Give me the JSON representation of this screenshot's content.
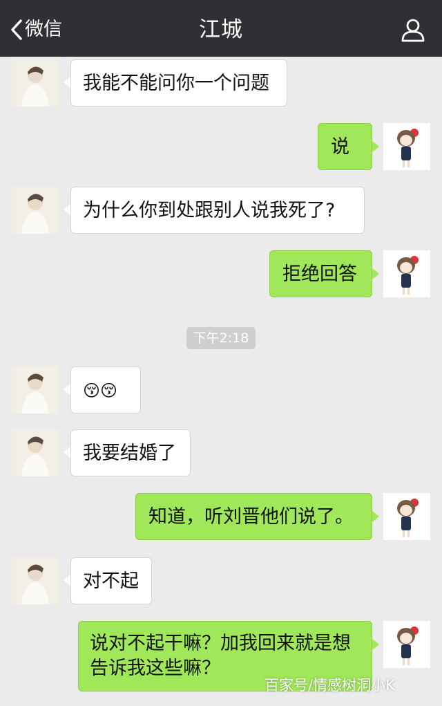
{
  "header": {
    "back_label": "微信",
    "title": "江城",
    "profile_icon": "person-icon"
  },
  "messages": [
    {
      "from": "them",
      "text": "我能不能问你一个问题"
    },
    {
      "from": "me",
      "text": "说"
    },
    {
      "from": "them",
      "text": "为什么你到处跟别人说我死了?"
    },
    {
      "from": "me",
      "text": "拒绝回答"
    },
    {
      "from": "them",
      "text": "😚😚"
    },
    {
      "from": "them",
      "text": "我要结婚了"
    },
    {
      "from": "me",
      "text": "知道，听刘晋他们说了。"
    },
    {
      "from": "them",
      "text": "对不起"
    },
    {
      "from": "me",
      "text": "说对不起干嘛？加我回来就是想\n告诉我这些嘛？"
    }
  ],
  "timestamp": "下午2:18",
  "watermark": "百家号/情感树洞小K",
  "colors": {
    "header_bg": "#2f3034",
    "chat_bg": "#ebebeb",
    "bubble_me": "#a0e75a",
    "bubble_them": "#ffffff"
  }
}
